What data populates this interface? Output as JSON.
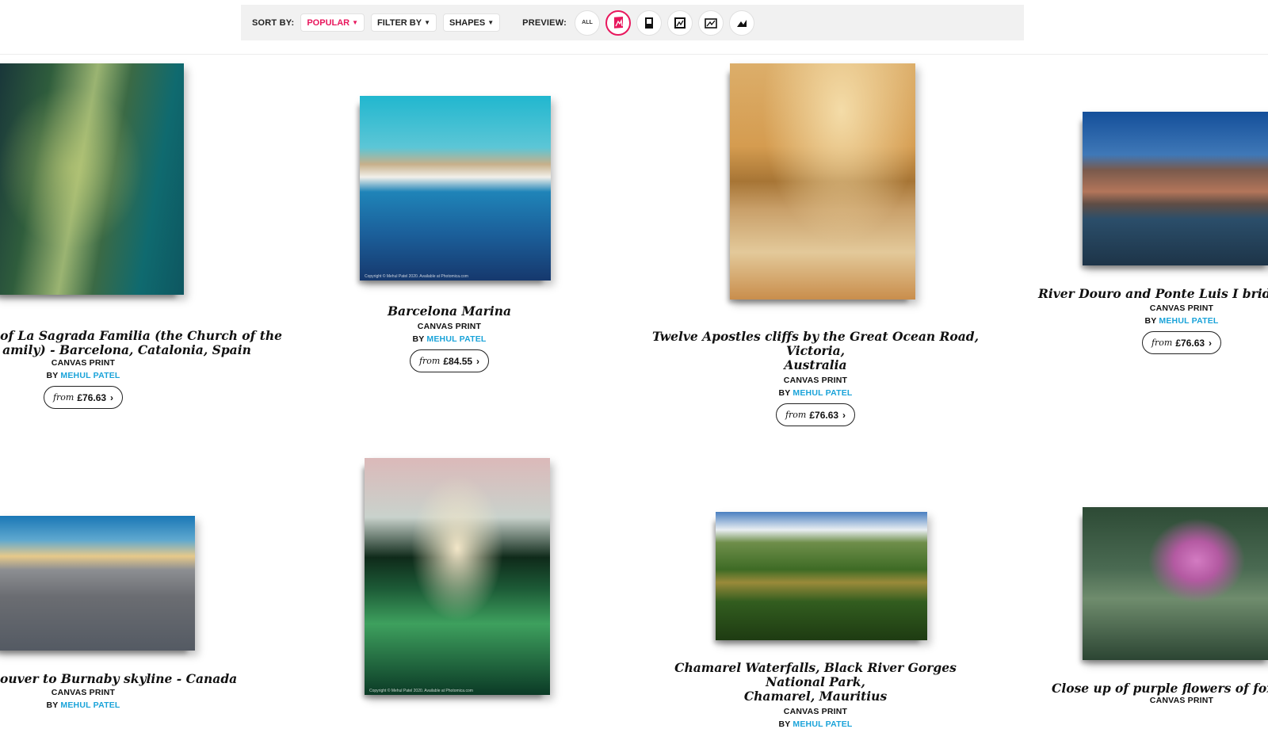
{
  "toolbar": {
    "sort_label": "SORT BY:",
    "sort_value": "POPULAR",
    "filter_label": "FILTER BY",
    "shapes_label": "SHAPES",
    "preview_label": "PREVIEW:",
    "preview_all": "ALL",
    "accent_color": "#e8175d",
    "preview_icons": [
      "all",
      "portrait-selected-icon",
      "panorama-icon",
      "square-icon",
      "landscape-icon",
      "wide-icon"
    ]
  },
  "products": [
    {
      "title": "ade of La Sagrada Familia (the Church of the amily) - Barcelona, Catalonia, Spain",
      "title_line1": "ade of La Sagrada Familia (the Church of the",
      "title_line2": "amily) - Barcelona, Catalonia, Spain",
      "type": "CANVAS PRINT",
      "by": "BY",
      "artist": "MEHUL PATEL",
      "from": "from",
      "price": "£76.63"
    },
    {
      "title": "Barcelona Marina",
      "type": "CANVAS PRINT",
      "by": "BY",
      "artist": "MEHUL PATEL",
      "from": "from",
      "price": "£84.55",
      "copyright": "Copyright © Mehul Patel 2020. Available at Photomica.com"
    },
    {
      "title_line1": "Twelve Apostles cliffs by the Great Ocean Road, Victoria,",
      "title_line2": "Australia",
      "type": "CANVAS PRINT",
      "by": "BY",
      "artist": "MEHUL PATEL",
      "from": "from",
      "price": "£76.63"
    },
    {
      "title": "River Douro and Ponte Luis I bridge - Po",
      "type": "CANVAS PRINT",
      "by": "BY",
      "artist": "MEHUL PATEL",
      "from": "from",
      "price": "£76.63"
    },
    {
      "title": "ouver to Burnaby skyline - Canada",
      "type": "CANVAS PRINT",
      "by": "BY",
      "artist": "MEHUL PATEL"
    },
    {
      "copyright": "Copyright © Mehul Patel 2020. Available at Photomica.com"
    },
    {
      "title_line1": "Chamarel Waterfalls, Black River Gorges National Park,",
      "title_line2": "Chamarel, Mauritius",
      "type": "CANVAS PRINT",
      "by": "BY",
      "artist": "MEHUL PATEL"
    },
    {
      "title": "Close up of purple flowers of foxglove (",
      "type": "CANVAS PRINT"
    }
  ]
}
